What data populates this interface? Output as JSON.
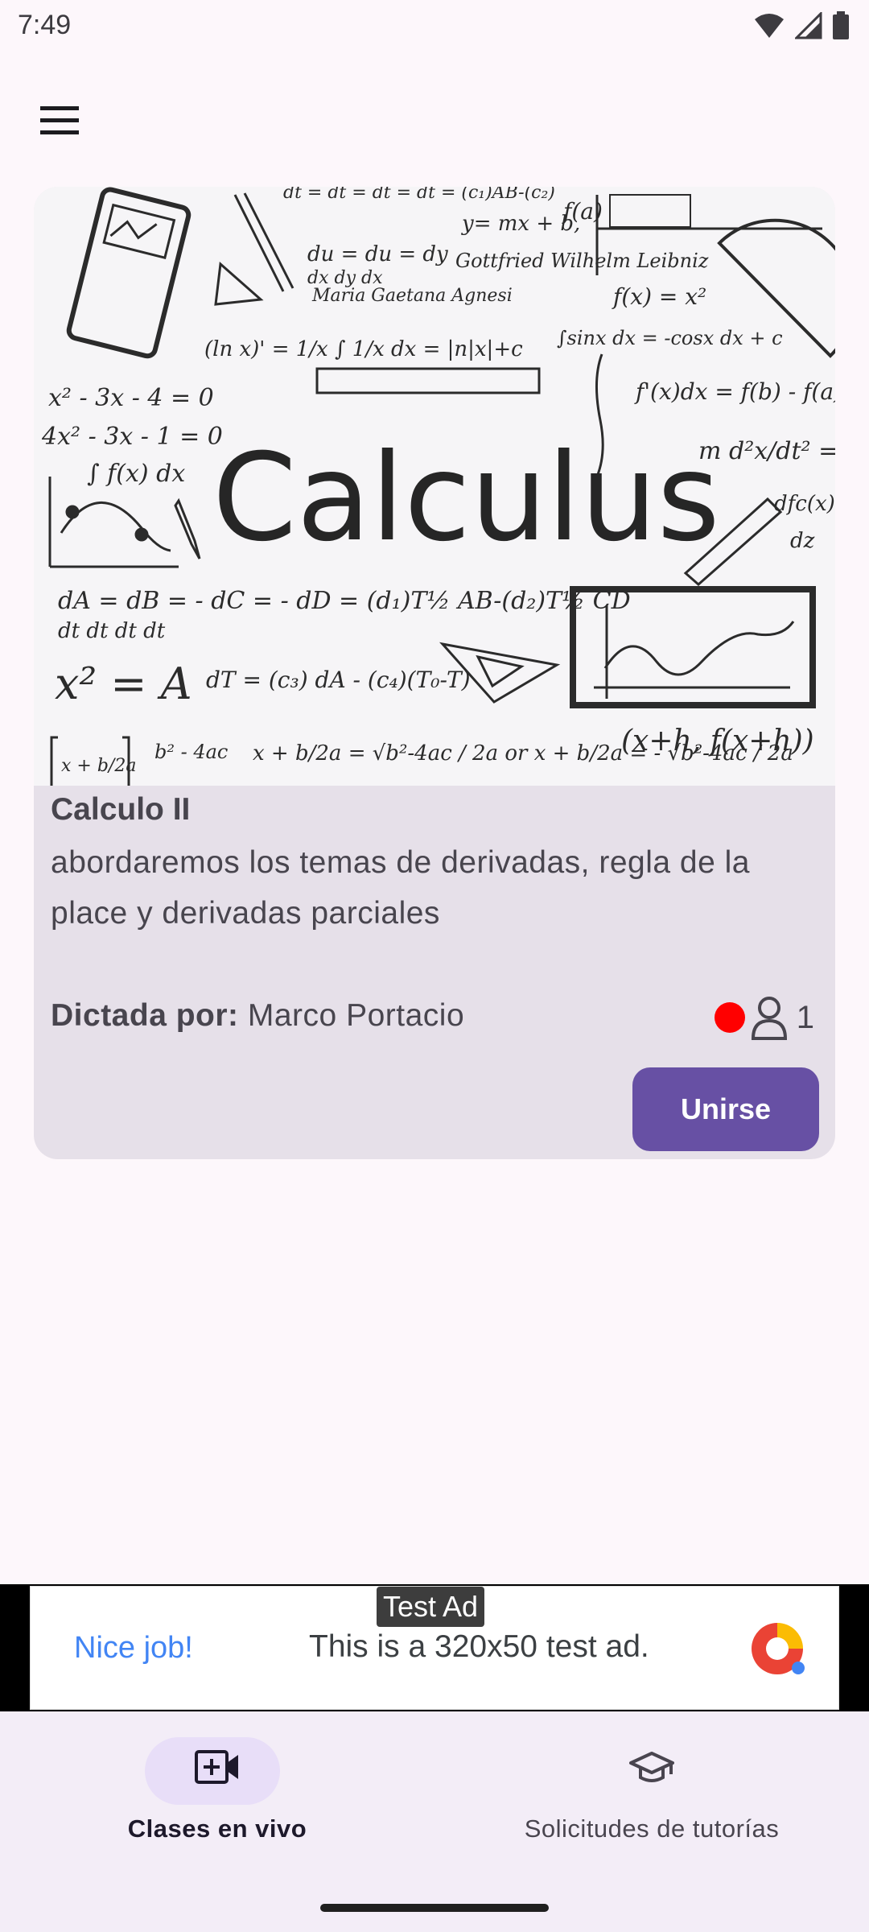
{
  "status_bar": {
    "time": "7:49",
    "icons": [
      "wifi-icon",
      "signal-icon",
      "battery-icon"
    ]
  },
  "top_bar": {
    "menu_icon": "menu-icon"
  },
  "card": {
    "image_title": "Calculus",
    "title": "Calculo II",
    "description": "abordaremos los temas de derivadas, regla de la place y derivadas parciales",
    "instructor_label": "Dictada por:",
    "instructor_name": "Marco Portacio",
    "viewer_count": "1",
    "join_label": "Unirse",
    "live_color": "#ff0000",
    "accent": "#6750a4"
  },
  "ad": {
    "badge": "Test Ad",
    "left_text": "Nice job!",
    "text": "This is a 320x50 test ad."
  },
  "bottom_nav": {
    "items": [
      {
        "label": "Clases en vivo",
        "icon": "video-add-icon",
        "selected": true
      },
      {
        "label": "Solicitudes de tutorías",
        "icon": "graduation-cap-icon",
        "selected": false
      }
    ]
  }
}
